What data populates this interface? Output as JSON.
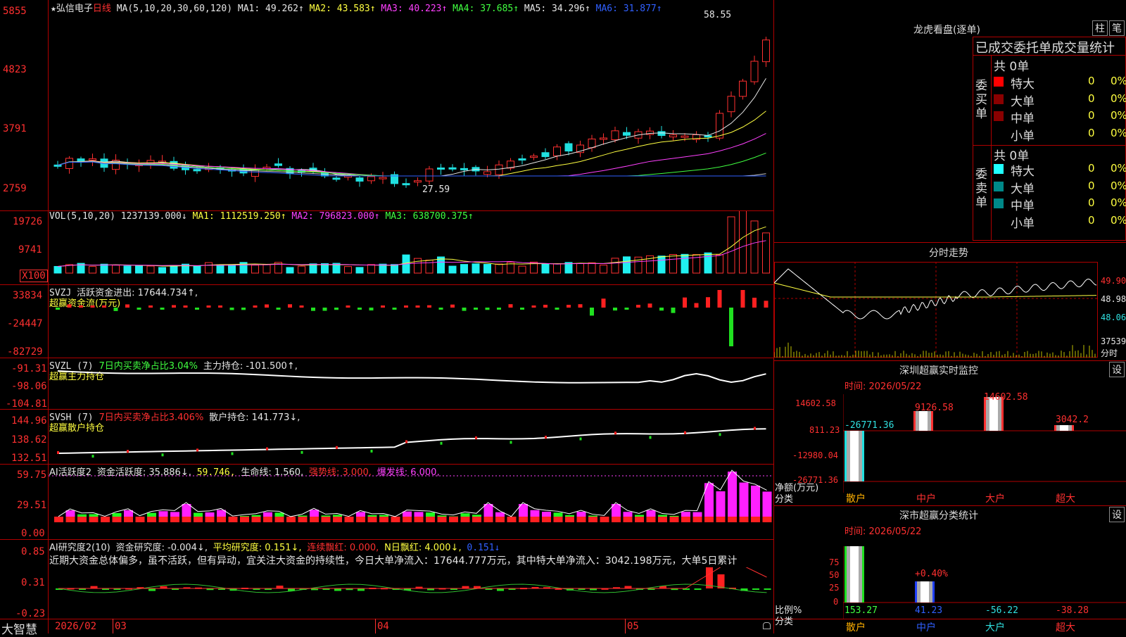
{
  "stock": {
    "star": "★",
    "name": "弘信电子",
    "period": "日线"
  },
  "main": {
    "ma_label": "MA(5,10,20,30,60,120)",
    "ma1": "MA1: 49.262↑",
    "ma2": "MA2: 43.583↑",
    "ma3": "MA3: 40.223↑",
    "ma4": "MA4: 37.685↑",
    "ma5": "MA5: 34.296↑",
    "ma6": "MA6: 31.877↑",
    "yticks": [
      "5855",
      "4823",
      "3791",
      "2759"
    ],
    "high_label": "58.55",
    "low_label": "27.59"
  },
  "vol": {
    "label": "VOL(5,10,20)",
    "val": "1237139.000↓",
    "ma1": "MA1: 1112519.250↑",
    "ma2": "MA2: 796823.000↑",
    "ma3": "MA3: 638700.375↑",
    "yticks": [
      "19726",
      "9741"
    ],
    "unit": "X100"
  },
  "svzj": {
    "name": "SVZJ",
    "desc": "活跃资金进出: 17644.734↑,",
    "sub": "超赢资金流(万元)",
    "yticks": [
      "33834",
      "-24447",
      "-82729"
    ]
  },
  "svzl": {
    "name": "SVZL (7)",
    "desc1": "7日内买卖净占比3.04%",
    "desc2": "主力持仓: -101.500↑,",
    "sub": "超赢主力持仓",
    "yticks": [
      "-91.31",
      "-98.06",
      "-104.81"
    ]
  },
  "svsh": {
    "name": "SVSH (7)",
    "desc1": "7日内买卖净占比3.406%",
    "desc2": "散户持仓: 141.773↓,",
    "sub": "超赢散户持仓",
    "yticks": [
      "144.96",
      "138.62",
      "132.51"
    ]
  },
  "ai1": {
    "name": "AI活跃度2",
    "d1": "资金活跃度: 35.886↓,",
    "d2": "59.746,",
    "d3": "生命线: 1.560,",
    "d4": "强势线: 3.000,",
    "d5": "爆发线: 6.000,",
    "yticks": [
      "59.75",
      "29.51",
      "0.00"
    ]
  },
  "ai2": {
    "name": "AI研究度2(10)",
    "d1": "资金研究度: -0.004↓,",
    "d2": "平均研究度: 0.151↓,",
    "d3": "连续飘红: 0.000,",
    "d4": "N日飘红: 4.000↓,",
    "d5": "0.151↓",
    "text": "近期大资金总体偏多，虽不活跃，但有异动，宜关注大资金的持续性，今日大单净流入：17644.777万元，其中特大单净流入：3042.198万元，大单5日累计",
    "yticks": [
      "0.85",
      "0.31",
      "-0.23"
    ]
  },
  "xaxis": {
    "brand": "大智慧",
    "labels": [
      "2026/02",
      "03",
      "04",
      "05"
    ]
  },
  "longhu": {
    "title": "龙虎看盘(逐单)",
    "btn1": "柱",
    "btn2": "笔",
    "subtitle": "已成交委托单成交量统计",
    "buy_label": "委买单",
    "sell_label": "委卖单",
    "buy_total": "共 0单",
    "sell_total": "共 0单",
    "buy_rows": [
      {
        "name": "特大",
        "v": "0",
        "p": "0%"
      },
      {
        "name": "大单",
        "v": "0",
        "p": "0%"
      },
      {
        "name": "中单",
        "v": "0",
        "p": "0%"
      },
      {
        "name": "小单",
        "v": "0",
        "p": "0%"
      }
    ],
    "sell_rows": [
      {
        "name": "特大",
        "v": "0",
        "p": "0%"
      },
      {
        "name": "大单",
        "v": "0",
        "p": "0%"
      },
      {
        "name": "中单",
        "v": "0",
        "p": "0%"
      },
      {
        "name": "小单",
        "v": "0",
        "p": "0%"
      }
    ],
    "buy_colors": [
      "#ff0000",
      "#8a0000",
      "#8a0000",
      "#000000"
    ],
    "sell_colors": [
      "#20ffff",
      "#008888",
      "#008888",
      "#000000"
    ]
  },
  "intraday": {
    "title": "分时走势",
    "p1": "49.90",
    "p2": "48.98",
    "p3": "48.06",
    "vol": "37539",
    "vol_unit": "分时"
  },
  "monitor": {
    "title": "深圳超赢实时监控",
    "btn": "设",
    "time": "时间: 2026/05/22",
    "yticks": [
      "14602.58",
      "811.23",
      "-12980.04",
      "-26771.36"
    ],
    "ylabel1": "净额(万元)",
    "ylabel2": "分类",
    "bar_labels": [
      "-26771.36",
      "9126.58",
      "14602.58",
      "3042.2"
    ],
    "cats": [
      "散户",
      "中户",
      "大户",
      "超大"
    ]
  },
  "classify": {
    "title": "深市超赢分类统计",
    "btn": "设",
    "time": "时间: 2026/05/22",
    "yticks": [
      "75",
      "50",
      "25",
      "0"
    ],
    "ylabel1": "比例%",
    "ylabel2": "分类",
    "bar_labels": [
      "153.27",
      "41.23",
      "-56.22",
      "-38.28"
    ],
    "top_label": "+0.40%",
    "cats": [
      "散户",
      "中户",
      "大户",
      "超大"
    ]
  }
}
